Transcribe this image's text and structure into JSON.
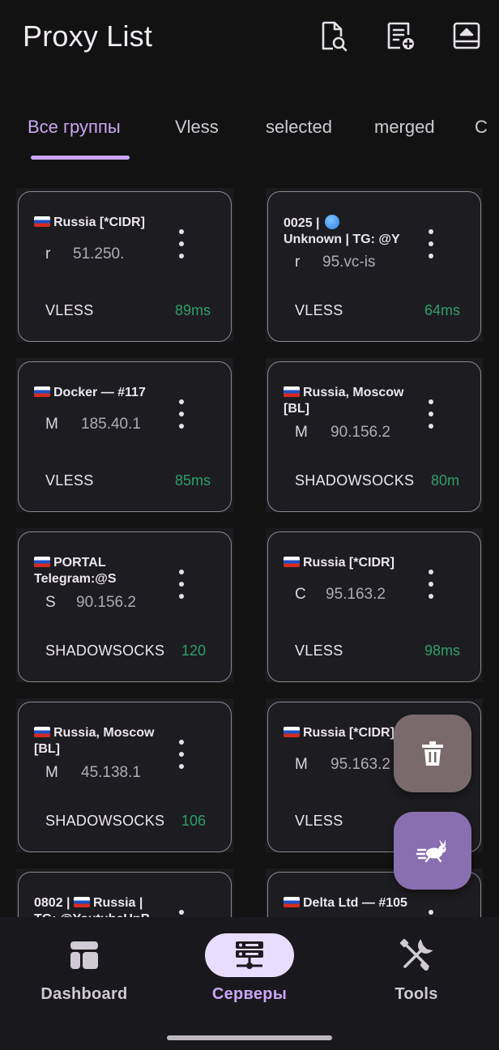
{
  "app": {
    "title": "Proxy List"
  },
  "tabs": [
    {
      "label": "Все группы",
      "active": true
    },
    {
      "label": "Vless"
    },
    {
      "label": "selected"
    },
    {
      "label": "merged"
    },
    {
      "label": "C"
    }
  ],
  "cards": [
    {
      "flag": "ru",
      "name": "Russia [*CIDR]",
      "sub": "r",
      "addr": "51.250.",
      "protocol": "VLESS",
      "ping": "89ms"
    },
    {
      "flag": "",
      "name_prefix": "0025 |",
      "globe": true,
      "name": "Unknown | TG: @Y",
      "sub": "r",
      "addr": "95.vc-is",
      "protocol": "VLESS",
      "ping": "64ms"
    },
    {
      "flag": "ru",
      "name": "Docker — #117",
      "sub": "M",
      "addr": "185.40.1",
      "protocol": "VLESS",
      "ping": "85ms"
    },
    {
      "flag": "ru",
      "name": "Russia, Moscow [BL]",
      "sub": "M",
      "addr": "90.156.2",
      "protocol": "SHADOWSOCKS",
      "ping": "80m"
    },
    {
      "flag": "ru",
      "name": "PORTAL Telegram:@S",
      "sub": "S",
      "addr": "90.156.2",
      "protocol": "SHADOWSOCKS",
      "ping": "120"
    },
    {
      "flag": "ru",
      "name": "Russia [*CIDR]",
      "sub": "C",
      "addr": "95.163.2",
      "protocol": "VLESS",
      "ping": "98ms"
    },
    {
      "flag": "ru",
      "name": "Russia, Moscow [BL]",
      "sub": "M",
      "addr": "45.138.1",
      "protocol": "SHADOWSOCKS",
      "ping": "106"
    },
    {
      "flag": "ru",
      "name": "Russia [*CIDR]",
      "sub": "M",
      "addr": "95.163.2",
      "protocol": "VLESS",
      "ping": ""
    },
    {
      "flag": "",
      "name_prefix": "0802 |",
      "name_flag_after": true,
      "name": "Russia | TG: @YoutubeUnB",
      "sub": "",
      "addr": "",
      "protocol": "",
      "ping": ""
    },
    {
      "flag": "ru",
      "name": "Delta Ltd — #105",
      "sub": "",
      "addr": "",
      "protocol": "",
      "ping": ""
    }
  ],
  "nav": [
    {
      "label": "Dashboard",
      "icon": "dashboard-icon"
    },
    {
      "label": "Серверы",
      "icon": "servers-icon",
      "active": true
    },
    {
      "label": "Tools",
      "icon": "tools-icon"
    }
  ],
  "colors": {
    "accent": "#c9a7f5",
    "ping_good": "#2e9f6b",
    "fab_delete": "#7b6a6d",
    "fab_run": "#8a6fb0",
    "background": "#121212"
  }
}
